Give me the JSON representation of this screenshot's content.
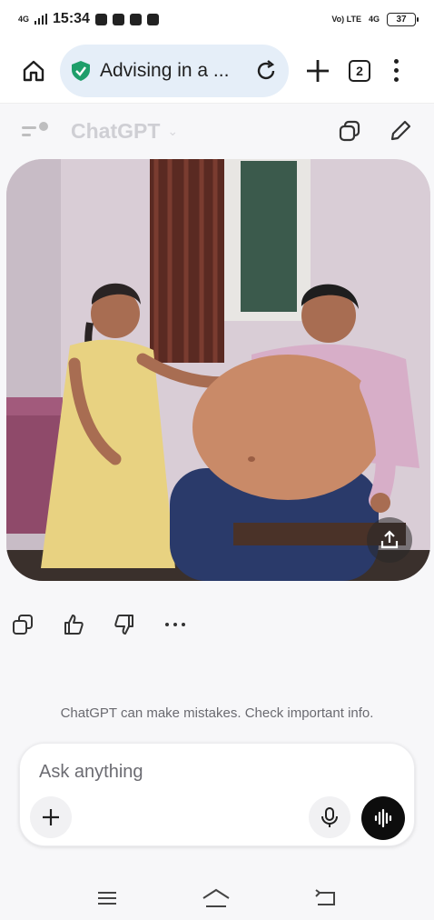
{
  "status": {
    "network": "4G",
    "time": "15:34",
    "right_network_1": "Vo) LTE",
    "right_network_2": "4G",
    "battery": "37"
  },
  "browser": {
    "tab_title": "Advising in a ...",
    "tab_count": "2",
    "secure_color": "#1e9e6a"
  },
  "chat": {
    "title": "ChatGPT",
    "image_alt": "Generated image of an older woman in a yellow dress seated beside a man in a pink shirt in a room with curtains",
    "disclaimer": "ChatGPT can make mistakes. Check important info.",
    "composer_placeholder": "Ask anything"
  },
  "icons": {
    "home": "home-icon",
    "shield": "shield-check-icon",
    "reload": "reload-icon",
    "new_tab": "plus-icon",
    "menu": "kebab-menu-icon",
    "sidebar": "sidebar-icon",
    "copy_chat": "copy-icon",
    "edit": "pencil-icon",
    "share": "share-icon",
    "copy": "copy-icon",
    "thumbs_up": "thumbs-up-icon",
    "thumbs_down": "thumbs-down-icon",
    "more": "more-horizontal-icon",
    "attach": "plus-icon",
    "mic": "mic-icon",
    "voice": "voice-waveform-icon",
    "nav_menu": "nav-menu-icon",
    "nav_home": "nav-home-icon",
    "nav_back": "nav-back-icon"
  }
}
